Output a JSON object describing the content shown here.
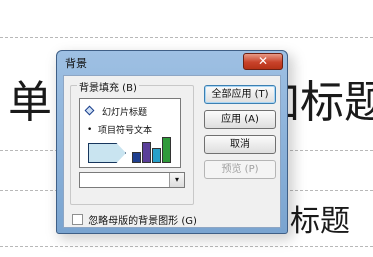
{
  "slide": {
    "title_left": "单",
    "title_right": "加标题",
    "subtitle": "加标题"
  },
  "dialog": {
    "title": "背景",
    "close_glyph": "✕",
    "fill_group_label": "背景填充 (B)",
    "preview": {
      "slide_title_text": "幻灯片标题",
      "bullet_glyph": "•",
      "bullet_text": "项目符号文本",
      "bar_colors": [
        "#1f3f8f",
        "#5a3f99",
        "#27a0c8",
        "#2f9a3a"
      ],
      "bar_levels": [
        0.35,
        0.7,
        0.5,
        0.85
      ]
    },
    "fill_combo": {
      "value": "",
      "dropdown_glyph": "▾"
    },
    "buttons": {
      "apply_all": "全部应用 (T)",
      "apply": "应用 (A)",
      "cancel": "取消",
      "preview": "预览 (P)"
    },
    "omit_master_graphics": {
      "label": "忽略母版的背景图形 (G)",
      "checked": false
    }
  }
}
